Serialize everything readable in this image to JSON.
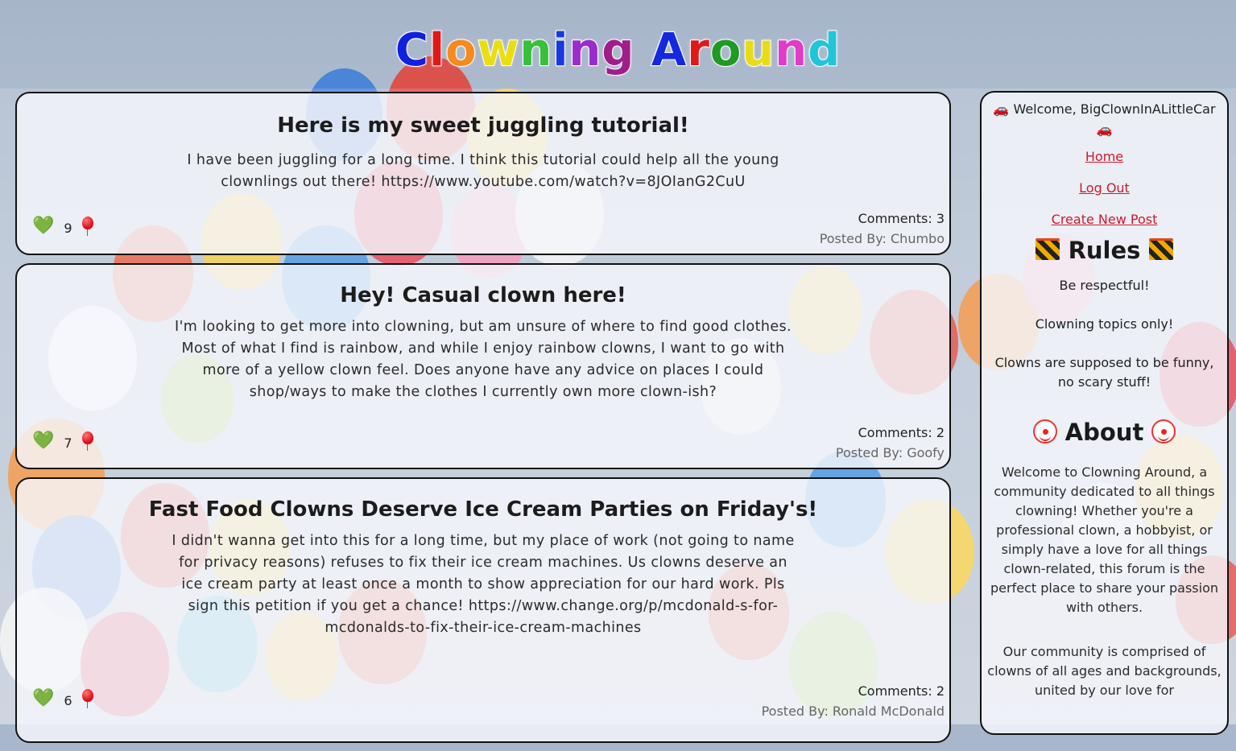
{
  "site": {
    "title_letters": [
      {
        "ch": "C",
        "color": "#1020e0"
      },
      {
        "ch": "l",
        "color": "#e01818"
      },
      {
        "ch": "o",
        "color": "#f58a1e"
      },
      {
        "ch": "w",
        "color": "#eadd12"
      },
      {
        "ch": "n",
        "color": "#37c03a"
      },
      {
        "ch": "i",
        "color": "#1a38e0"
      },
      {
        "ch": "n",
        "color": "#9b2bcc"
      },
      {
        "ch": "g",
        "color": "#a01e8a"
      },
      {
        "ch": " ",
        "color": "#000000"
      },
      {
        "ch": "A",
        "color": "#1428e0"
      },
      {
        "ch": "r",
        "color": "#e01818"
      },
      {
        "ch": "o",
        "color": "#1f9a24"
      },
      {
        "ch": "u",
        "color": "#e8dc1a"
      },
      {
        "ch": "n",
        "color": "#e03cc8"
      },
      {
        "ch": "d",
        "color": "#22c4d8"
      }
    ]
  },
  "posts": [
    {
      "title": "Here is my sweet juggling tutorial!",
      "body": "I have been juggling for a long time. I think this tutorial could help all the young clownlings out there! https://www.youtube.com/watch?v=8JOIanG2CuU",
      "likes": "9",
      "comments": "Comments: 3",
      "author": "Posted By: Chumbo"
    },
    {
      "title": "Hey! Casual clown here!",
      "body": "I'm looking to get more into clowning, but am unsure of where to find good clothes. Most of what I find is rainbow, and while I enjoy rainbow clowns, I want to go with more of a yellow clown feel. Does anyone have any advice on places I could shop/ways to make the clothes I currently own more clown-ish?",
      "likes": "7",
      "comments": "Comments: 2",
      "author": "Posted By: Goofy"
    },
    {
      "title": "Fast Food Clowns Deserve Ice Cream Parties on Friday's!",
      "body": "I didn't wanna get into this for a long time, but my place of work (not going to name for privacy reasons) refuses to fix their ice cream machines. Us clowns deserve an ice cream party at least once a month to show appreciation for our hard work. Pls sign this petition if you get a chance! https://www.change.org/p/mcdonald-s-for-mcdonalds-to-fix-their-ice-cream-machines",
      "likes": "6",
      "comments": "Comments: 2",
      "author": "Posted By: Ronald McDonald"
    }
  ],
  "sidebar": {
    "welcome": "Welcome, BigClownInALittleCar",
    "links": [
      "Home",
      "Log Out",
      "Create New Post"
    ],
    "rules_heading": "Rules",
    "rules": [
      "Be respectful!",
      "Clowning topics only!",
      "Clowns are supposed to be funny, no scary stuff!"
    ],
    "about_heading": "About",
    "about_paragraphs": [
      "Welcome to Clowning Around, a community dedicated to all things clowning! Whether you're a professional clown, a hobbyist, or simply have a love for all things clown-related, this forum is the perfect place to share your passion with others.",
      "Our community is comprised of clowns of all ages and backgrounds, united by our love for"
    ]
  },
  "icons": {
    "like": "green-heart-icon",
    "dislike": "red-balloon-icon",
    "car": "car-icon",
    "rules": "construction-barrier-icon",
    "about": "clown-face-icon"
  },
  "colors": {
    "link": "#d1182a",
    "card_border": "#111111",
    "background": "#a9b7cc"
  }
}
